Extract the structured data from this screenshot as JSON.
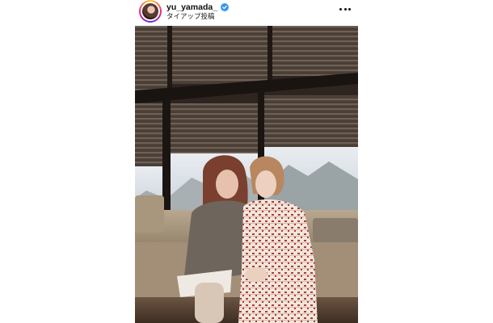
{
  "post_header": {
    "username": "yu_yamada_",
    "subtitle": "タイアップ投稿",
    "verified": true,
    "more_icon": "more-horizontal-icon",
    "verified_icon": "verified-badge-icon"
  },
  "colors": {
    "verified_blue": "#3897f0",
    "text_primary": "#111111"
  }
}
